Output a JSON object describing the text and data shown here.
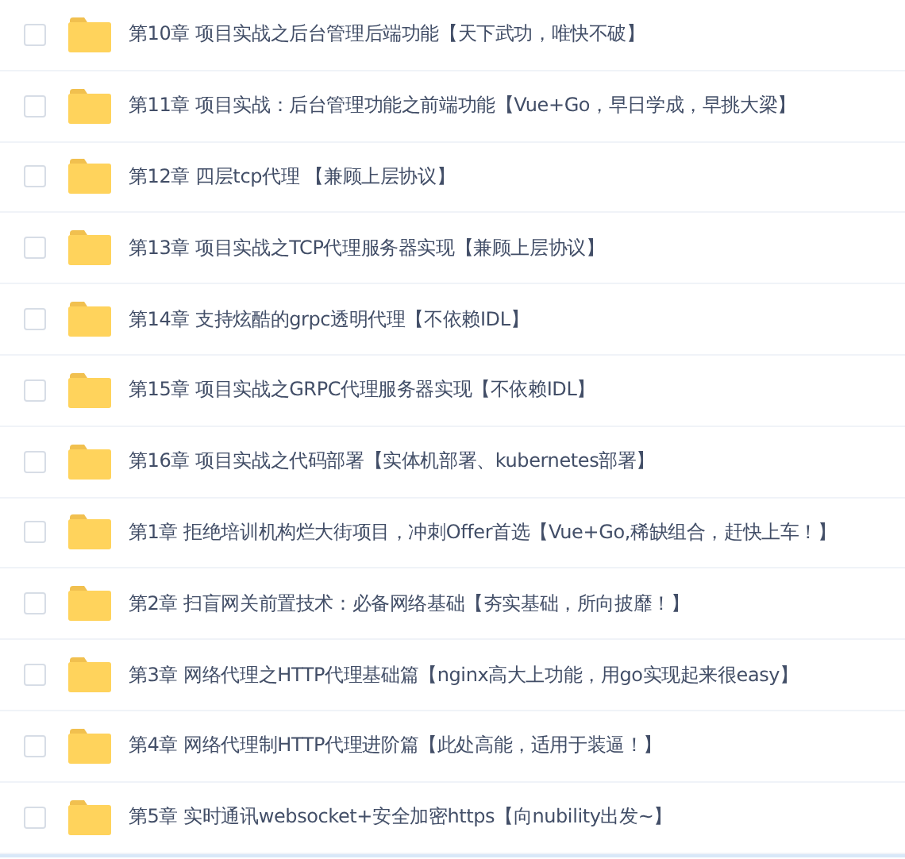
{
  "folders": [
    {
      "name": "第10章 项目实战之后台管理后端功能【天下武功，唯快不破】",
      "checked": false
    },
    {
      "name": "第11章 项目实战：后台管理功能之前端功能【Vue+Go，早日学成，早挑大梁】",
      "checked": false
    },
    {
      "name": "第12章 四层tcp代理 【兼顾上层协议】",
      "checked": false
    },
    {
      "name": "第13章 项目实战之TCP代理服务器实现【兼顾上层协议】",
      "checked": false
    },
    {
      "name": "第14章 支持炫酷的grpc透明代理【不依赖IDL】",
      "checked": false
    },
    {
      "name": "第15章 项目实战之GRPC代理服务器实现【不依赖IDL】",
      "checked": false
    },
    {
      "name": "第16章 项目实战之代码部署【实体机部署、kubernetes部署】",
      "checked": false
    },
    {
      "name": "第1章 拒绝培训机构烂大街项目，冲刺Offer首选【Vue+Go,稀缺组合，赶快上车！】",
      "checked": false
    },
    {
      "name": "第2章 扫盲网关前置技术：必备网络基础【夯实基础，所向披靡！】",
      "checked": false
    },
    {
      "name": "第3章 网络代理之HTTP代理基础篇【nginx高大上功能，用go实现起来很easy】",
      "checked": false
    },
    {
      "name": "第4章 网络代理制HTTP代理进阶篇【此处高能，适用于装逼！】",
      "checked": false
    },
    {
      "name": "第5章 实时通讯websocket+安全加密https【向nubility出发~】",
      "checked": false
    }
  ]
}
